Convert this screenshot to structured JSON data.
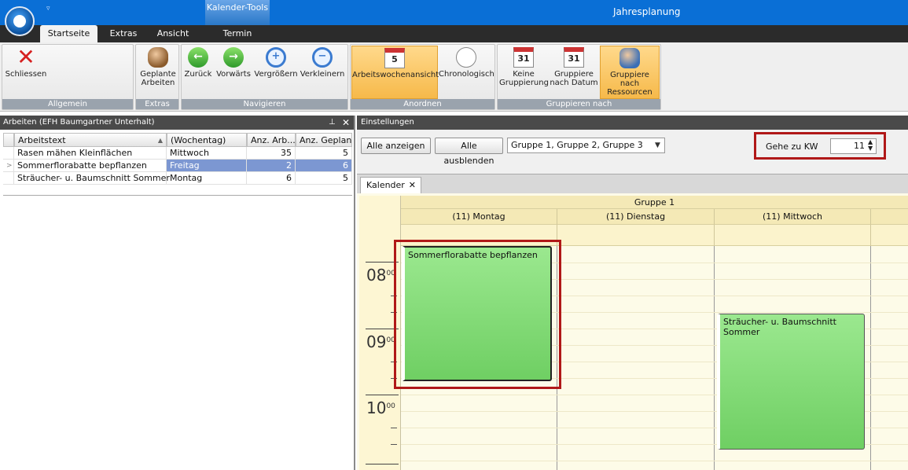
{
  "window": {
    "title": "Jahresplanung",
    "context_tab": "Kalender-Tools"
  },
  "ribbon_tabs": [
    "Startseite",
    "Extras",
    "Ansicht",
    "Termin"
  ],
  "ribbon": {
    "groups": [
      "Allgemein",
      "Extras",
      "Navigieren",
      "Anordnen",
      "Gruppieren nach"
    ],
    "buttons": {
      "schliessen": "Schliessen",
      "geplante_1": "Geplante",
      "geplante_2": "Arbeiten",
      "zurueck": "Zurück",
      "vorwaerts": "Vorwärts",
      "vergroessern": "Vergrößern",
      "verkleinern": "Verkleinern",
      "arbeitswoche": "Arbeitswochenansicht",
      "arbeitswoche_num": "5",
      "chronologisch": "Chronologisch",
      "keine_1": "Keine",
      "keine_2": "Gruppierung",
      "datum_1": "Gruppiere",
      "datum_2": "nach Datum",
      "datum_num": "31",
      "ressourcen_1": "Gruppiere nach",
      "ressourcen_2": "Ressourcen",
      "keine_num": "31"
    }
  },
  "left_pane": {
    "title": "Arbeiten (EFH Baumgartner Unterhalt)",
    "columns": [
      "Arbeitstext",
      "(Wochentag)",
      "Anz. Arb...",
      "Anz. Geplant"
    ],
    "rows": [
      {
        "text": "Rasen mähen Kleinflächen",
        "day": "Mittwoch",
        "arb": "35",
        "geplant": "5",
        "selected": false
      },
      {
        "text": "Sommerflorabatte bepflanzen",
        "day": "Freitag",
        "arb": "2",
        "geplant": "6",
        "selected": true
      },
      {
        "text": "Sträucher- u. Baumschnitt Sommer",
        "day": "Montag",
        "arb": "6",
        "geplant": "5",
        "selected": false
      }
    ]
  },
  "right_pane": {
    "title": "Einstellungen",
    "show_all": "Alle anzeigen",
    "hide_all": "Alle ausblenden",
    "group_combo": "Gruppe 1, Gruppe 2, Gruppe 3",
    "goto_kw_label": "Gehe zu KW",
    "goto_kw_value": "11",
    "calendar_tab": "Kalender",
    "group_header": "Gruppe 1",
    "days": [
      "(11) Montag",
      "(11) Dienstag",
      "(11) Mittwoch"
    ],
    "hours": [
      "08",
      "09",
      "10"
    ],
    "minutes_sup": "00",
    "appointments": [
      {
        "text": "Sommerflorabatte bepflanzen",
        "day": "(11) Montag"
      },
      {
        "text": "Sträucher- u. Baumschnitt Sommer",
        "day": "(11) Mittwoch"
      }
    ]
  },
  "colors": {
    "accent": "#0a6fd6",
    "selection": "#7c97d2",
    "appointment": "#8de07f",
    "highlight": "#b01818"
  }
}
